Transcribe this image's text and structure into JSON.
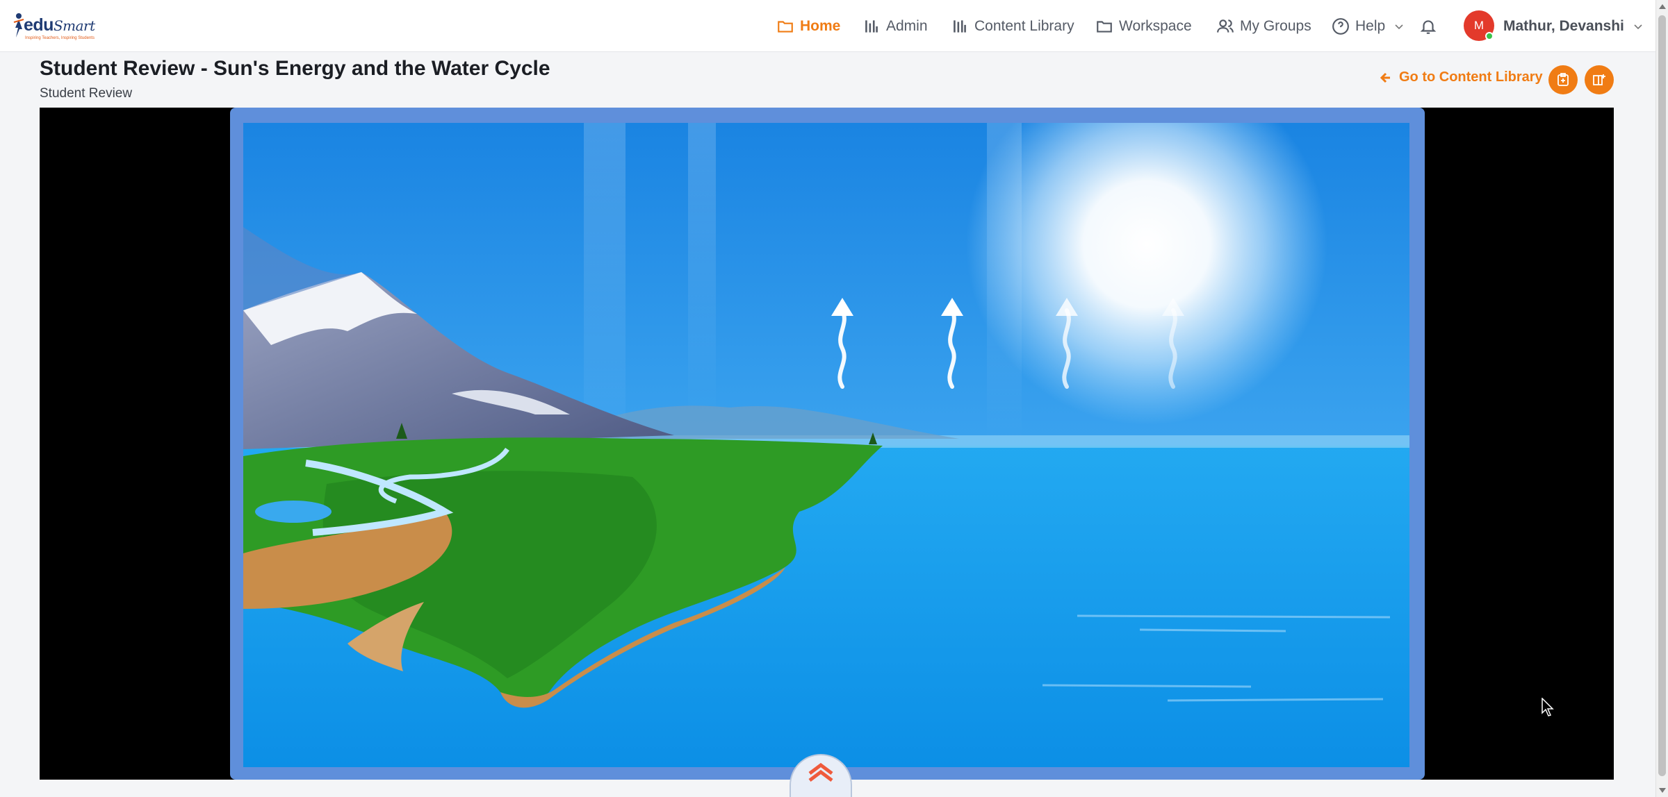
{
  "header": {
    "logo": {
      "brand_prefix": "edu",
      "brand_suffix": "Smart",
      "tagline": "Inspiring Teachers, Inspiring Students"
    },
    "nav": [
      {
        "label": "Home",
        "icon": "folder-icon",
        "active": true
      },
      {
        "label": "Admin",
        "icon": "bars-icon",
        "active": false
      },
      {
        "label": "Content Library",
        "icon": "library-icon",
        "active": false
      },
      {
        "label": "Workspace",
        "icon": "folder-icon",
        "active": false
      },
      {
        "label": "My Groups",
        "icon": "users-icon",
        "active": false
      },
      {
        "label": "Help",
        "icon": "help-circle-icon",
        "active": false
      }
    ],
    "user": {
      "initial": "M",
      "name": "Mathur, Devanshi",
      "status": "online"
    }
  },
  "page": {
    "title": "Student Review - Sun's Energy and the Water Cycle",
    "subtitle": "Student Review",
    "back_link": "Go to Content Library"
  },
  "colors": {
    "accent": "#f07c14",
    "frame": "#5f8fdb",
    "sky": "#1b8be6",
    "ocean": "#0e97ea",
    "land": "#2e9b25",
    "avatar": "#e33a2b"
  },
  "player": {
    "scene": "water-cycle-animation",
    "evaporation_arrows": 4
  }
}
